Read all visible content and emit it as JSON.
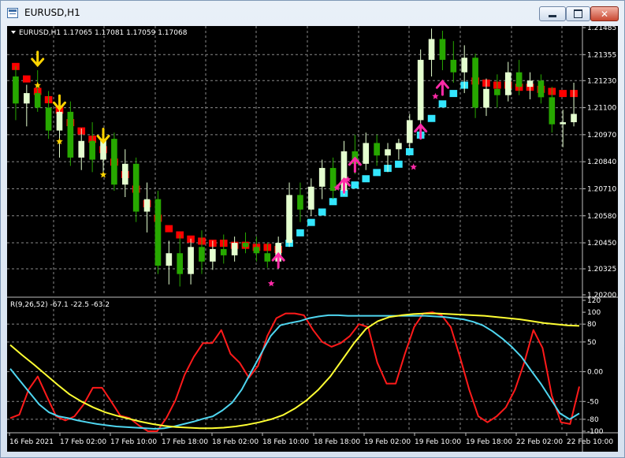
{
  "window": {
    "title": "EURUSD,H1",
    "min_label": "minimize",
    "max_label": "maximize",
    "close_label": "close"
  },
  "main_panel": {
    "label": "EURUSD,H1  1.17065 1.17081 1.17059 1.17068",
    "price_labels": [
      "1.21485",
      "1.21355",
      "1.21230",
      "1.21100",
      "1.20970",
      "1.20840",
      "1.20710",
      "1.20580",
      "1.20450",
      "1.20325",
      "1.20200"
    ]
  },
  "indicator_panel": {
    "label": "R(9,26,52) -67.1 -22.5 -63.2",
    "scale_labels": [
      "120",
      "100",
      "80",
      "50",
      "0.00",
      "-50",
      "-80",
      "-100"
    ]
  },
  "time_labels": [
    "16 Feb 2021",
    "17 Feb 02:00",
    "17 Feb 10:00",
    "17 Feb 18:00",
    "18 Feb 02:00",
    "18 Feb 10:00",
    "18 Feb 18:00",
    "19 Feb 02:00",
    "19 Feb 10:00",
    "19 Feb 18:00",
    "22 Feb 02:00",
    "22 Feb 10:00"
  ],
  "colors": {
    "background": "#000000",
    "grid": "#8a8a8a",
    "text": "#ffffff",
    "bull_candle": "#e4ffcf",
    "bear_candle": "#27a800",
    "down_trend": "#ff0000",
    "up_trend": "#33e6ff",
    "down_arrow": "#ffd400",
    "up_arrow": "#ff2aa8",
    "line_red": "#ff1a1a",
    "line_cyan": "#4fd6f0",
    "line_yellow": "#ffff33"
  },
  "chart_data": {
    "type": "candlestick",
    "price_ylim": [
      1.202,
      1.21485
    ],
    "candles": [
      {
        "o": 1.2125,
        "h": 1.213,
        "l": 1.2104,
        "c": 1.2112
      },
      {
        "o": 1.2112,
        "h": 1.2121,
        "l": 1.2101,
        "c": 1.2117
      },
      {
        "o": 1.2117,
        "h": 1.2128,
        "l": 1.2108,
        "c": 1.211
      },
      {
        "o": 1.211,
        "h": 1.2118,
        "l": 1.2095,
        "c": 1.2099
      },
      {
        "o": 1.2099,
        "h": 1.2114,
        "l": 1.2086,
        "c": 1.2108
      },
      {
        "o": 1.2108,
        "h": 1.2113,
        "l": 1.2082,
        "c": 1.2086
      },
      {
        "o": 1.2086,
        "h": 1.21,
        "l": 1.208,
        "c": 1.2094
      },
      {
        "o": 1.2094,
        "h": 1.2103,
        "l": 1.2079,
        "c": 1.2085
      },
      {
        "o": 1.2085,
        "h": 1.2099,
        "l": 1.2079,
        "c": 1.2095
      },
      {
        "o": 1.2095,
        "h": 1.2098,
        "l": 1.207,
        "c": 1.2073
      },
      {
        "o": 1.2073,
        "h": 1.209,
        "l": 1.2067,
        "c": 1.2083
      },
      {
        "o": 1.2083,
        "h": 1.2086,
        "l": 1.2055,
        "c": 1.206
      },
      {
        "o": 1.206,
        "h": 1.2074,
        "l": 1.205,
        "c": 1.2066
      },
      {
        "o": 1.2066,
        "h": 1.207,
        "l": 1.203,
        "c": 1.2034
      },
      {
        "o": 1.2034,
        "h": 1.2046,
        "l": 1.2025,
        "c": 1.204
      },
      {
        "o": 1.204,
        "h": 1.2049,
        "l": 1.2024,
        "c": 1.203
      },
      {
        "o": 1.203,
        "h": 1.2047,
        "l": 1.2025,
        "c": 1.2043
      },
      {
        "o": 1.2043,
        "h": 1.2051,
        "l": 1.203,
        "c": 1.2036
      },
      {
        "o": 1.2036,
        "h": 1.2046,
        "l": 1.2032,
        "c": 1.2042
      },
      {
        "o": 1.2042,
        "h": 1.2049,
        "l": 1.2035,
        "c": 1.2039
      },
      {
        "o": 1.2039,
        "h": 1.2048,
        "l": 1.2036,
        "c": 1.2045
      },
      {
        "o": 1.2045,
        "h": 1.205,
        "l": 1.204,
        "c": 1.2043
      },
      {
        "o": 1.2043,
        "h": 1.2048,
        "l": 1.2036,
        "c": 1.204
      },
      {
        "o": 1.204,
        "h": 1.2045,
        "l": 1.2033,
        "c": 1.2036
      },
      {
        "o": 1.2036,
        "h": 1.2048,
        "l": 1.2034,
        "c": 1.2045
      },
      {
        "o": 1.2045,
        "h": 1.2074,
        "l": 1.2043,
        "c": 1.2068
      },
      {
        "o": 1.2068,
        "h": 1.2074,
        "l": 1.2055,
        "c": 1.2061
      },
      {
        "o": 1.2061,
        "h": 1.2076,
        "l": 1.2058,
        "c": 1.2072
      },
      {
        "o": 1.2072,
        "h": 1.2085,
        "l": 1.2066,
        "c": 1.2081
      },
      {
        "o": 1.2081,
        "h": 1.2086,
        "l": 1.2066,
        "c": 1.207
      },
      {
        "o": 1.207,
        "h": 1.2094,
        "l": 1.2068,
        "c": 1.2089
      },
      {
        "o": 1.2089,
        "h": 1.2097,
        "l": 1.2078,
        "c": 1.2083
      },
      {
        "o": 1.2083,
        "h": 1.2098,
        "l": 1.208,
        "c": 1.2093
      },
      {
        "o": 1.2093,
        "h": 1.2097,
        "l": 1.2082,
        "c": 1.2087
      },
      {
        "o": 1.2087,
        "h": 1.2093,
        "l": 1.2079,
        "c": 1.209
      },
      {
        "o": 1.209,
        "h": 1.2095,
        "l": 1.2085,
        "c": 1.2093
      },
      {
        "o": 1.2093,
        "h": 1.2107,
        "l": 1.209,
        "c": 1.2104
      },
      {
        "o": 1.2104,
        "h": 1.2138,
        "l": 1.21,
        "c": 1.2133
      },
      {
        "o": 1.2133,
        "h": 1.2148,
        "l": 1.2125,
        "c": 1.2143
      },
      {
        "o": 1.2143,
        "h": 1.2147,
        "l": 1.2128,
        "c": 1.2133
      },
      {
        "o": 1.2133,
        "h": 1.2142,
        "l": 1.2122,
        "c": 1.2127
      },
      {
        "o": 1.2127,
        "h": 1.214,
        "l": 1.2117,
        "c": 1.2134
      },
      {
        "o": 1.2134,
        "h": 1.2136,
        "l": 1.2105,
        "c": 1.211
      },
      {
        "o": 1.211,
        "h": 1.2124,
        "l": 1.2106,
        "c": 1.2119
      },
      {
        "o": 1.2119,
        "h": 1.2126,
        "l": 1.211,
        "c": 1.2116
      },
      {
        "o": 1.2116,
        "h": 1.2132,
        "l": 1.2113,
        "c": 1.2127
      },
      {
        "o": 1.2127,
        "h": 1.2133,
        "l": 1.2116,
        "c": 1.212
      },
      {
        "o": 1.212,
        "h": 1.2127,
        "l": 1.2114,
        "c": 1.2123
      },
      {
        "o": 1.2123,
        "h": 1.2126,
        "l": 1.2112,
        "c": 1.2115
      },
      {
        "o": 1.2115,
        "h": 1.212,
        "l": 1.2098,
        "c": 1.2102
      },
      {
        "o": 1.2102,
        "h": 1.2109,
        "l": 1.2091,
        "c": 1.2103
      },
      {
        "o": 1.2103,
        "h": 1.2122,
        "l": 1.2101,
        "c": 1.2107
      }
    ],
    "trend_dots": [
      {
        "v": 1.213,
        "t": "down"
      },
      {
        "v": 1.2124,
        "t": "down"
      },
      {
        "v": 1.2118,
        "t": "down"
      },
      {
        "v": 1.2114,
        "t": "down"
      },
      {
        "v": 1.2109,
        "t": "down"
      },
      {
        "v": 1.2103,
        "t": "down"
      },
      {
        "v": 1.2099,
        "t": "down"
      },
      {
        "v": 1.2095,
        "t": "down"
      },
      {
        "v": 1.209,
        "t": "down"
      },
      {
        "v": 1.2084,
        "t": "down"
      },
      {
        "v": 1.2078,
        "t": "down"
      },
      {
        "v": 1.2071,
        "t": "down"
      },
      {
        "v": 1.2064,
        "t": "down"
      },
      {
        "v": 1.2057,
        "t": "down"
      },
      {
        "v": 1.2052,
        "t": "down"
      },
      {
        "v": 1.2049,
        "t": "down"
      },
      {
        "v": 1.2047,
        "t": "down"
      },
      {
        "v": 1.2046,
        "t": "down"
      },
      {
        "v": 1.2045,
        "t": "down"
      },
      {
        "v": 1.2045,
        "t": "down"
      },
      {
        "v": 1.2044,
        "t": "down"
      },
      {
        "v": 1.2044,
        "t": "down"
      },
      {
        "v": 1.2043,
        "t": "down"
      },
      {
        "v": 1.2043,
        "t": "down"
      },
      {
        "v": 1.2042,
        "t": "down"
      },
      {
        "v": 1.2045,
        "t": "up"
      },
      {
        "v": 1.205,
        "t": "up"
      },
      {
        "v": 1.2055,
        "t": "up"
      },
      {
        "v": 1.206,
        "t": "up"
      },
      {
        "v": 1.2065,
        "t": "up"
      },
      {
        "v": 1.2069,
        "t": "up"
      },
      {
        "v": 1.2073,
        "t": "up"
      },
      {
        "v": 1.2076,
        "t": "up"
      },
      {
        "v": 1.2079,
        "t": "up"
      },
      {
        "v": 1.2081,
        "t": "up"
      },
      {
        "v": 1.2083,
        "t": "up"
      },
      {
        "v": 1.2089,
        "t": "up"
      },
      {
        "v": 1.2097,
        "t": "up"
      },
      {
        "v": 1.2105,
        "t": "up"
      },
      {
        "v": 1.2112,
        "t": "up"
      },
      {
        "v": 1.2117,
        "t": "up"
      },
      {
        "v": 1.2121,
        "t": "up"
      },
      {
        "v": 1.2123,
        "t": "down"
      },
      {
        "v": 1.2122,
        "t": "down"
      },
      {
        "v": 1.2121,
        "t": "down"
      },
      {
        "v": 1.2121,
        "t": "down"
      },
      {
        "v": 1.212,
        "t": "down"
      },
      {
        "v": 1.212,
        "t": "down"
      },
      {
        "v": 1.2119,
        "t": "down"
      },
      {
        "v": 1.2118,
        "t": "down"
      },
      {
        "v": 1.2117,
        "t": "down"
      },
      {
        "v": 1.2117,
        "t": "down"
      }
    ],
    "down_signals": [
      {
        "i": 2,
        "v": 1.2133,
        "star": 1.2123
      },
      {
        "i": 4,
        "v": 1.2112,
        "star": 1.2096
      },
      {
        "i": 8,
        "v": 1.2096,
        "star": 1.208
      }
    ],
    "up_signals": [
      {
        "i": 24,
        "v": 1.2037,
        "star": 1.203
      },
      {
        "i": 30,
        "v": 1.2073,
        "star": 1.2076
      },
      {
        "i": 31,
        "v": 1.2083,
        "star": 1.208
      },
      {
        "i": 37,
        "v": 1.2099,
        "star": 1.2086
      },
      {
        "i": 39,
        "v": 1.212,
        "star": 1.212
      }
    ],
    "indicator_ylim": [
      -100,
      120
    ],
    "series": [
      {
        "name": "red",
        "values": [
          -78,
          -72,
          -30,
          -8,
          -42,
          -75,
          -82,
          -75,
          -55,
          -27,
          -27,
          -50,
          -74,
          -78,
          -90,
          -100,
          -100,
          -78,
          -48,
          -5,
          25,
          48,
          48,
          70,
          30,
          15,
          -10,
          10,
          60,
          90,
          98,
          98,
          95,
          70,
          50,
          42,
          48,
          60,
          80,
          75,
          15,
          -20,
          -20,
          30,
          75,
          98,
          100,
          95,
          75,
          25,
          -30,
          -75,
          -85,
          -75,
          -60,
          -30,
          15,
          70,
          40,
          -40,
          -85,
          -88,
          -25
        ],
        "style_key": "line_red"
      },
      {
        "name": "cyan",
        "values": [
          5,
          -15,
          -35,
          -55,
          -68,
          -75,
          -78,
          -82,
          -85,
          -88,
          -90,
          -92,
          -93,
          -94,
          -95,
          -96,
          -95,
          -92,
          -88,
          -84,
          -79,
          -75,
          -65,
          -52,
          -30,
          0,
          30,
          60,
          78,
          82,
          85,
          90,
          93,
          95,
          95,
          94,
          94,
          94,
          94,
          94,
          94,
          94,
          94,
          94,
          93,
          92,
          90,
          88,
          84,
          78,
          68,
          56,
          42,
          25,
          2,
          -20,
          -45,
          -70,
          -80,
          -70
        ],
        "style_key": "line_cyan"
      },
      {
        "name": "yellow",
        "values": [
          45,
          28,
          12,
          -5,
          -22,
          -38,
          -50,
          -60,
          -68,
          -74,
          -79,
          -84,
          -88,
          -91,
          -93,
          -94,
          -95,
          -95,
          -94,
          -92,
          -89,
          -85,
          -80,
          -73,
          -62,
          -48,
          -30,
          -8,
          20,
          48,
          72,
          85,
          92,
          95,
          97,
          98,
          98,
          97,
          96,
          95,
          94,
          92,
          90,
          88,
          85,
          82,
          80,
          78,
          77
        ],
        "style_key": "line_yellow"
      }
    ]
  }
}
